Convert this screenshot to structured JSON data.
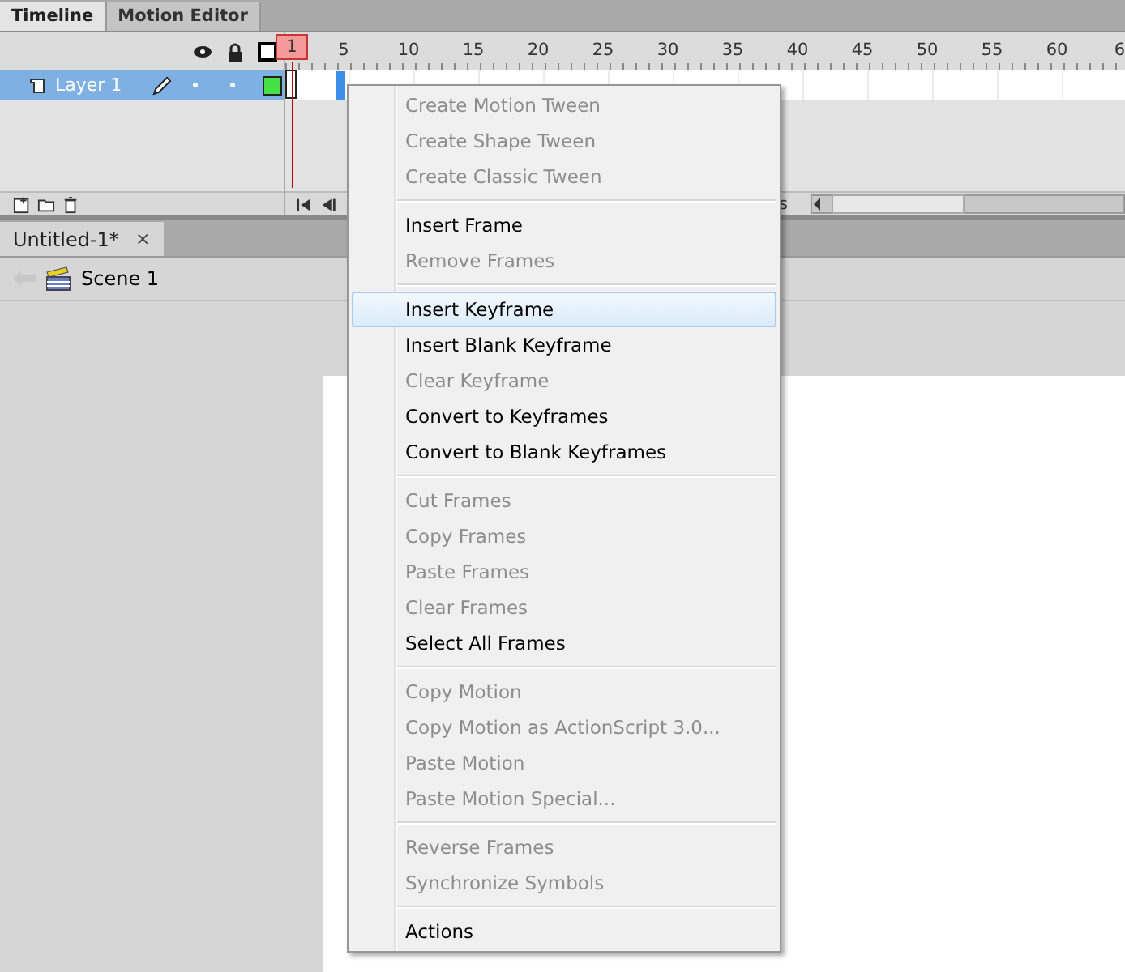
{
  "panel_tabs": [
    {
      "label": "Timeline",
      "selected": true
    },
    {
      "label": "Motion Editor",
      "selected": false
    }
  ],
  "layers": [
    {
      "name": "Layer 1",
      "selected": true
    }
  ],
  "ruler_labels": [
    "1",
    "5",
    "10",
    "15",
    "20",
    "25",
    "30",
    "35",
    "40",
    "45",
    "50",
    "55",
    "60",
    "6"
  ],
  "timeline_status": "s",
  "document_tabs": [
    {
      "label": "Untitled-1*",
      "close": "×"
    }
  ],
  "scene": {
    "label": "Scene 1"
  },
  "context_menu": {
    "sections": [
      [
        {
          "label": "Create Motion Tween",
          "disabled": true,
          "selected": false
        },
        {
          "label": "Create Shape Tween",
          "disabled": true,
          "selected": false
        },
        {
          "label": "Create Classic Tween",
          "disabled": true,
          "selected": false
        }
      ],
      [
        {
          "label": "Insert Frame",
          "disabled": false,
          "selected": false
        },
        {
          "label": "Remove Frames",
          "disabled": true,
          "selected": false
        }
      ],
      [
        {
          "label": "Insert Keyframe",
          "disabled": false,
          "selected": true
        },
        {
          "label": "Insert Blank Keyframe",
          "disabled": false,
          "selected": false
        },
        {
          "label": "Clear Keyframe",
          "disabled": true,
          "selected": false
        },
        {
          "label": "Convert to Keyframes",
          "disabled": false,
          "selected": false
        },
        {
          "label": "Convert to Blank Keyframes",
          "disabled": false,
          "selected": false
        }
      ],
      [
        {
          "label": "Cut Frames",
          "disabled": true,
          "selected": false
        },
        {
          "label": "Copy Frames",
          "disabled": true,
          "selected": false
        },
        {
          "label": "Paste Frames",
          "disabled": true,
          "selected": false
        },
        {
          "label": "Clear Frames",
          "disabled": true,
          "selected": false
        },
        {
          "label": "Select All Frames",
          "disabled": false,
          "selected": false
        }
      ],
      [
        {
          "label": "Copy Motion",
          "disabled": true,
          "selected": false
        },
        {
          "label": "Copy Motion as ActionScript 3.0...",
          "disabled": true,
          "selected": false
        },
        {
          "label": "Paste Motion",
          "disabled": true,
          "selected": false
        },
        {
          "label": "Paste Motion Special...",
          "disabled": true,
          "selected": false
        }
      ],
      [
        {
          "label": "Reverse Frames",
          "disabled": true,
          "selected": false
        },
        {
          "label": "Synchronize Symbols",
          "disabled": true,
          "selected": false
        }
      ],
      [
        {
          "label": "Actions",
          "disabled": false,
          "selected": false
        }
      ]
    ]
  }
}
